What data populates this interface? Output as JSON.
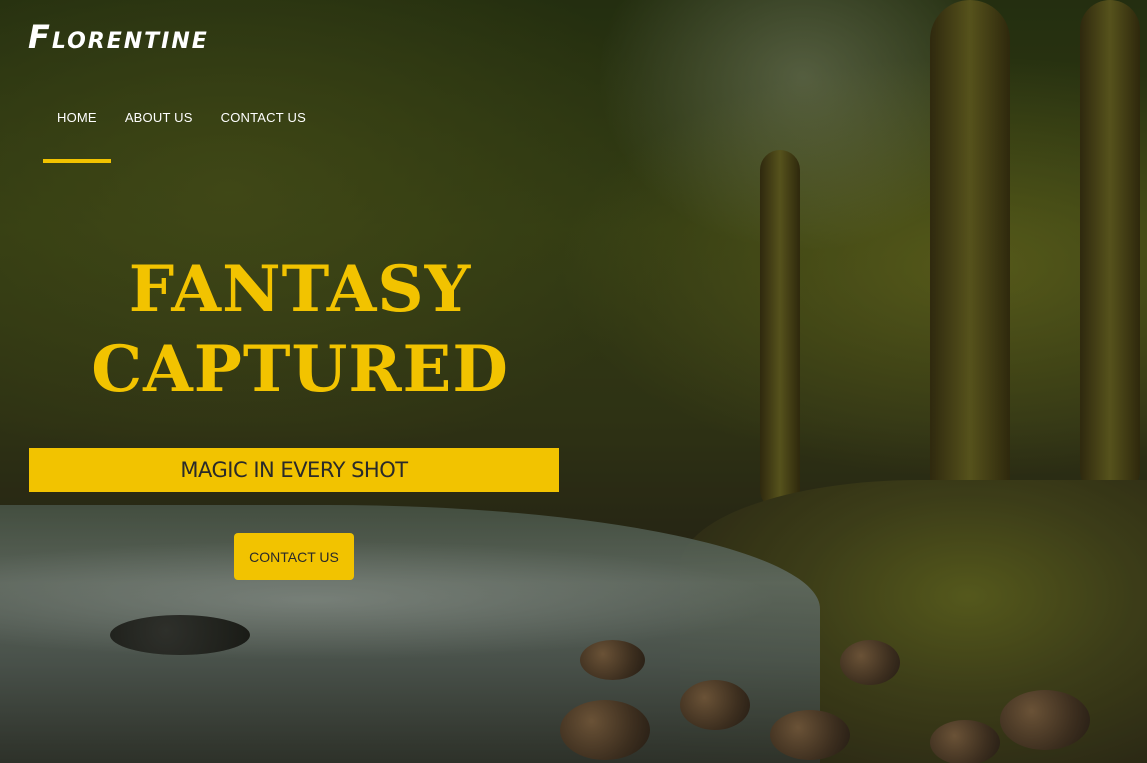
{
  "header": {
    "logo": "Florentine",
    "nav": [
      {
        "label": "HOME",
        "active": true
      },
      {
        "label": "ABOUT US",
        "active": false
      },
      {
        "label": "CONTACT US",
        "active": false
      }
    ]
  },
  "hero": {
    "headline_line1": "FANTASY",
    "headline_line2": "CAPTURED",
    "tagline": "MAGIC IN EVERY SHOT",
    "cta_label": "CONTACT US",
    "background": "mossy-forest-river-photo"
  },
  "colors": {
    "accent": "#f2c300",
    "text_light": "#ffffff",
    "text_dark": "#2a2a2a"
  }
}
